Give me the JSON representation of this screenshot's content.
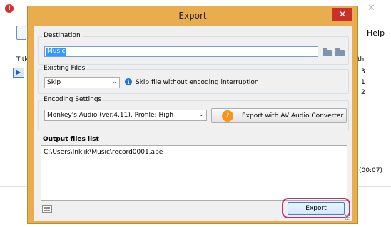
{
  "background_app": {
    "alert_icon": "error-icon",
    "close_glyph": "✕",
    "help_label": "Help",
    "title_column": "Title",
    "th_column": "th",
    "row_numbers": [
      "3",
      "1",
      "2"
    ],
    "duration": "(00:07)"
  },
  "dialog": {
    "title": "Export",
    "close_glyph": "✕",
    "destination": {
      "label": "Destination",
      "value": "Music",
      "browse_icon": "folder-open-icon",
      "new_folder_icon": "folder-new-icon"
    },
    "existing_files": {
      "label": "Existing Files",
      "selected": "Skip",
      "info_text": "Skip file without encoding interruption"
    },
    "encoding": {
      "label": "Encoding Settings",
      "selected": "Monkey's Audio (ver.4.11), Profile: High",
      "avac_button": "Export with AV Audio Converter"
    },
    "output": {
      "label": "Output files list",
      "items": [
        "C:\\Users\\Inklik\\Music\\record0001.ape"
      ]
    },
    "export_button": "Export"
  },
  "colors": {
    "dialog_frame": "#e8ad4e",
    "close_red": "#c9302c",
    "highlight_ring": "#c42b7a",
    "selection_blue": "#3399ff"
  }
}
